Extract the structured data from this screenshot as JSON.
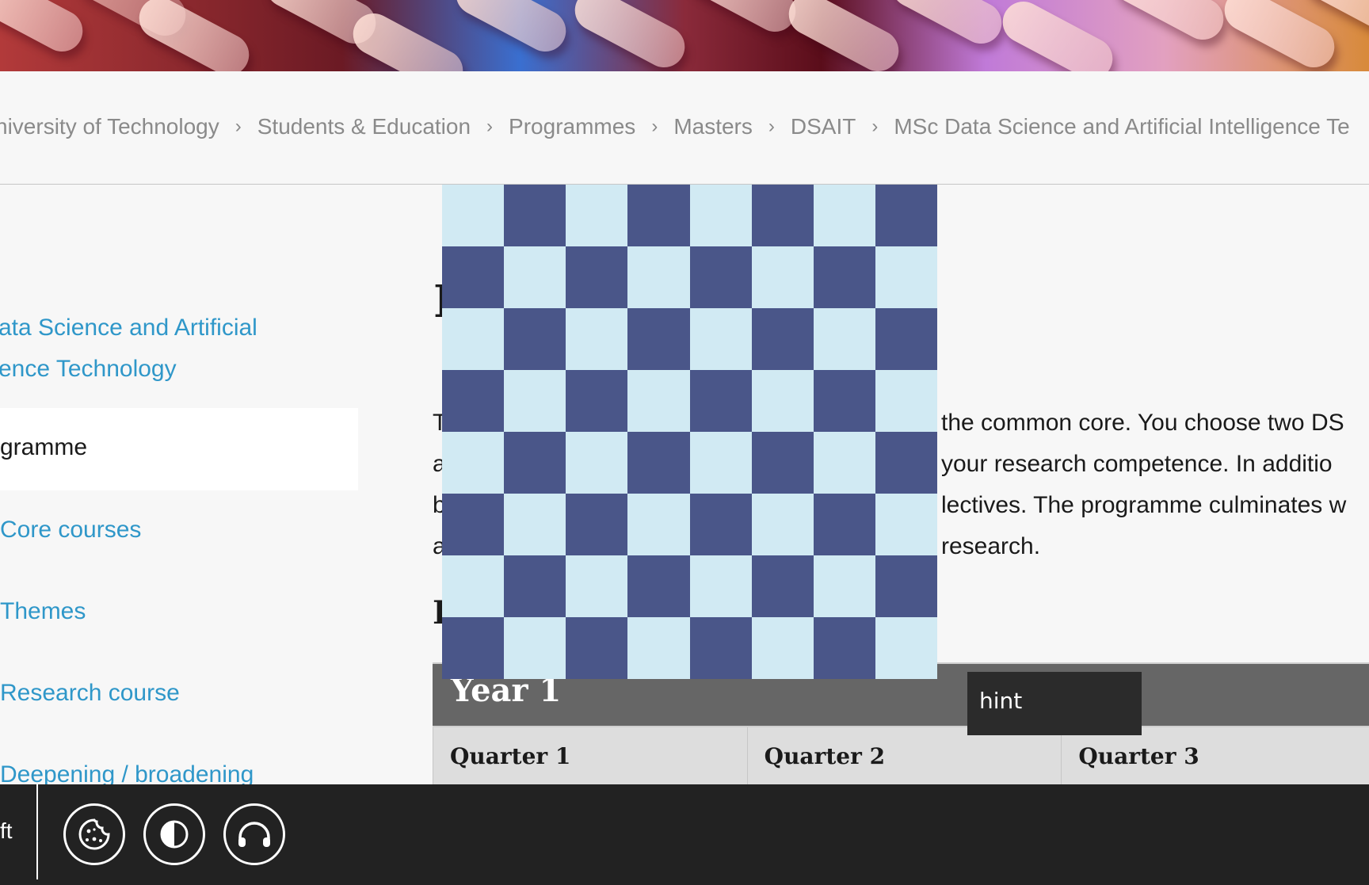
{
  "breadcrumb": {
    "items": [
      "niversity of Technology",
      "Students & Education",
      "Programmes",
      "Masters",
      "DSAIT",
      "MSc Data Science and Artificial Intelligence Te"
    ],
    "separator": "›"
  },
  "sidebar": {
    "title_line1": "ata Science and Artificial",
    "title_line2": "ence Technology",
    "active_item": "gramme",
    "items": [
      "Core courses",
      "Themes",
      "Research course",
      "Deepening / broadening"
    ]
  },
  "main": {
    "heading_fragment": "I",
    "paragraph": [
      {
        "start": "T",
        "end": "the common core. You choose two DS"
      },
      {
        "start": "a",
        "end": "your research competence. In additio"
      },
      {
        "start": "b",
        "end": "lectives. The programme culminates w"
      },
      {
        "start": "a",
        "end": "research."
      }
    ],
    "subheading_fragment": "F",
    "year_table": {
      "year_label": "Year 1",
      "quarters": [
        "Quarter 1",
        "Quarter 2",
        "Quarter 3"
      ]
    }
  },
  "overlay": {
    "tooltip": "hint",
    "checker_light": "#d1eaf3",
    "checker_dark": "#4a5689"
  },
  "bottom_bar": {
    "left_fragment": "ft",
    "buttons": [
      "cookie-icon",
      "contrast-icon",
      "headphones-icon"
    ]
  },
  "colors": {
    "link": "#2f97c9",
    "year_header_bg": "#666666",
    "bottom_bar_bg": "#222222"
  }
}
